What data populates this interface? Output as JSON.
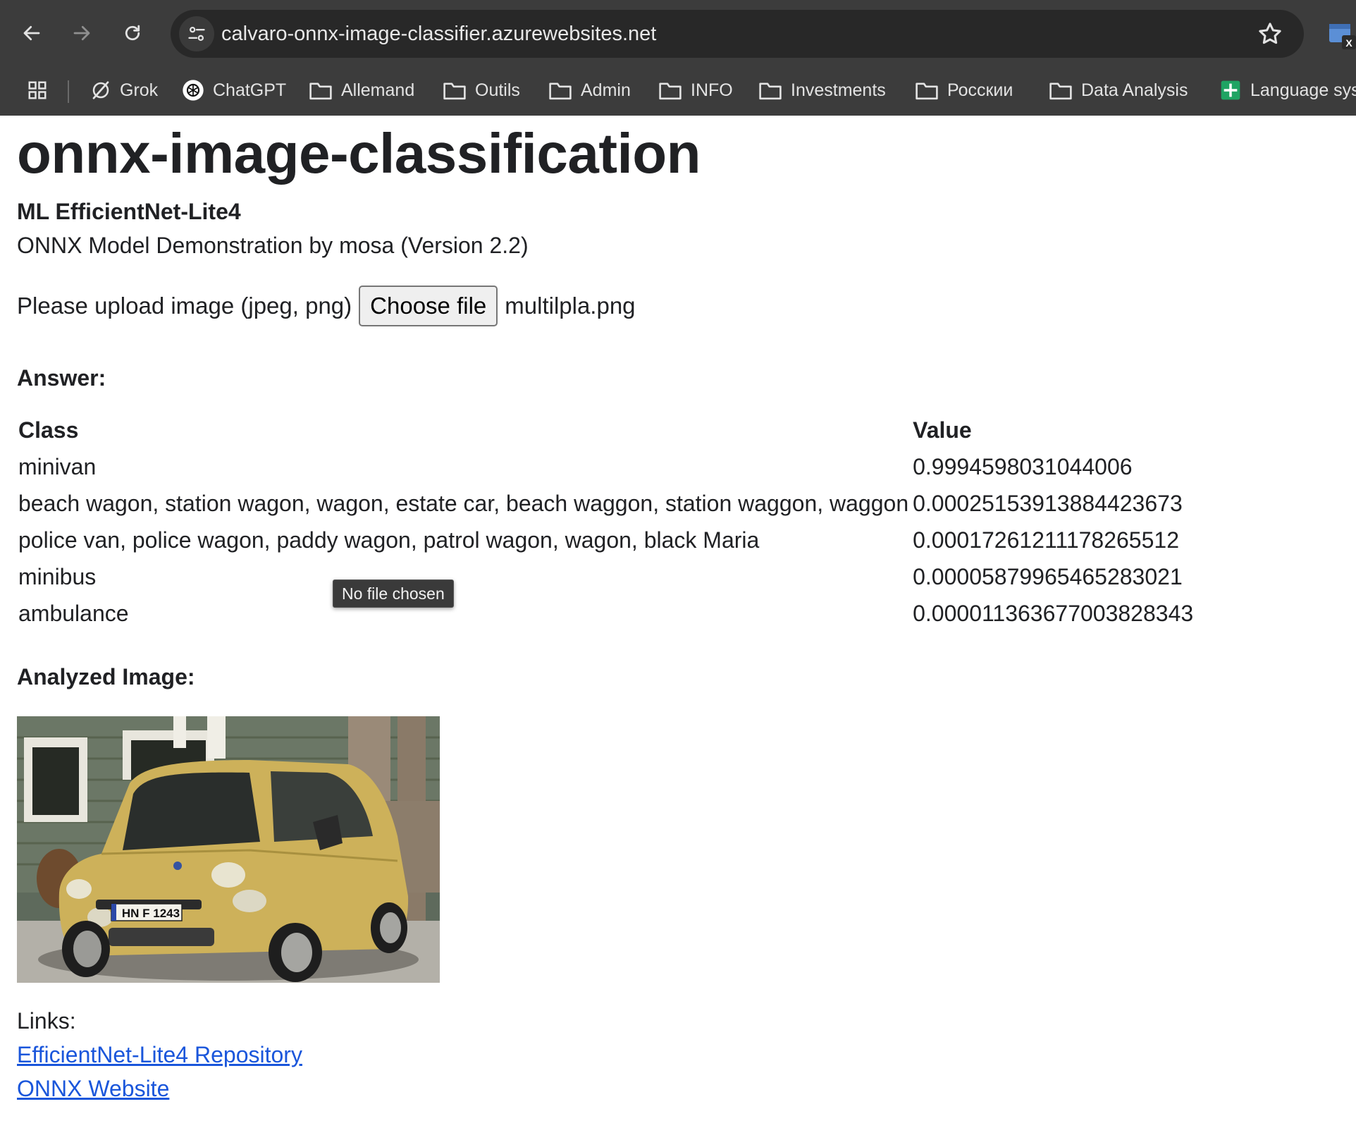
{
  "browser": {
    "url": "calvaro-onnx-image-classifier.azurewebsites.net",
    "bookmarks": [
      {
        "label": "Grok",
        "icon": "grok-icon"
      },
      {
        "label": "ChatGPT",
        "icon": "chatgpt-icon"
      },
      {
        "label": "Allemand",
        "icon": "folder-icon"
      },
      {
        "label": "Outils",
        "icon": "folder-icon"
      },
      {
        "label": "Admin",
        "icon": "folder-icon"
      },
      {
        "label": "INFO",
        "icon": "folder-icon"
      },
      {
        "label": "Investments",
        "icon": "folder-icon"
      },
      {
        "label": "Росскии",
        "icon": "folder-icon"
      },
      {
        "label": "Data Analysis",
        "icon": "folder-icon"
      },
      {
        "label": "Language sys",
        "icon": "sheets-icon"
      }
    ]
  },
  "page": {
    "title": "onnx-image-classification",
    "model_name": "ML EfficientNet-Lite4",
    "subtitle": "ONNX Model Demonstration by mosa (Version 2.2)",
    "upload": {
      "label": "Please upload image (jpeg, png)",
      "button_label": "Choose file",
      "file_name": "multilpla.png",
      "tooltip": "No file chosen"
    },
    "answer_heading": "Answer:",
    "results": {
      "headers": {
        "class": "Class",
        "value": "Value"
      },
      "rows": [
        {
          "class": "minivan",
          "value": "0.9994598031044006"
        },
        {
          "class": "beach wagon, station wagon, wagon, estate car, beach waggon, station waggon, waggon",
          "value": "0.00025153913884423673"
        },
        {
          "class": "police van, police wagon, paddy wagon, patrol wagon, wagon, black Maria",
          "value": "0.00017261211178265512"
        },
        {
          "class": "minibus",
          "value": "0.00005879965465283021"
        },
        {
          "class": "ambulance",
          "value": "0.000011363677003828343"
        }
      ]
    },
    "analyzed_heading": "Analyzed Image:",
    "car_plate": "HN F 1243",
    "links_label": "Links:",
    "links": [
      {
        "label": "EfficientNet-Lite4 Repository"
      },
      {
        "label": "ONNX Website"
      }
    ]
  }
}
